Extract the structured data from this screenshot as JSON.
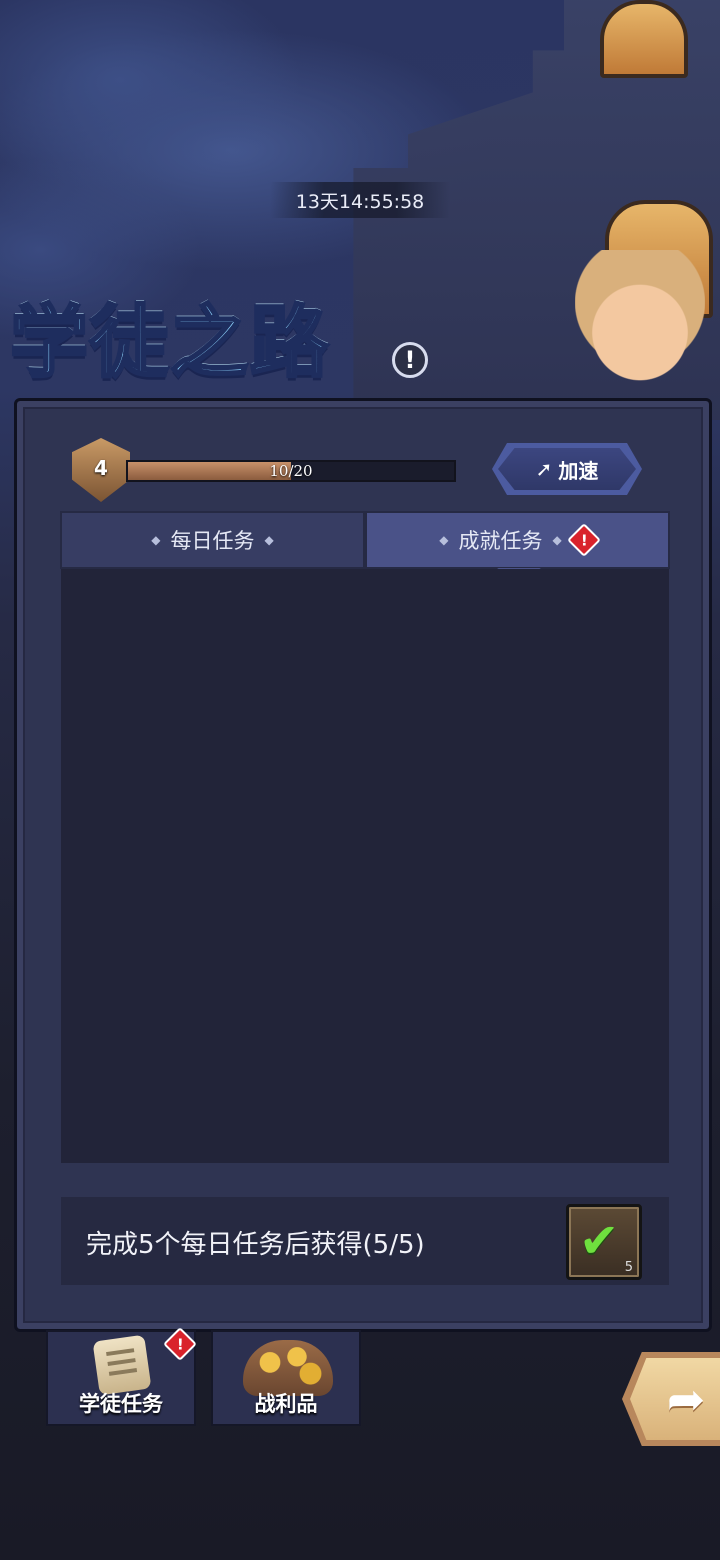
{
  "header": {
    "timer": "13天14:55:58",
    "title": "学徒之路",
    "info_icon": "exclamation-icon"
  },
  "level": {
    "value": "4",
    "progress_text": "10/20",
    "progress_fraction": 0.5
  },
  "speed_button": {
    "label": "加速",
    "icon": "speed-arrow-icon"
  },
  "tabs": [
    {
      "label": "每日任务",
      "active": false,
      "alert": false
    },
    {
      "label": "成就任务",
      "active": true,
      "alert": true
    }
  ],
  "reward": {
    "text": "完成5个每日任务后获得(5/5)",
    "item_count": "5",
    "status": "completed"
  },
  "bottom_nav": [
    {
      "label": "学徒任务",
      "icon": "scroll-icon",
      "alert": true
    },
    {
      "label": "战利品",
      "icon": "treasure-icon",
      "alert": false
    }
  ],
  "alert_symbol": "!",
  "colors": {
    "panel": "#2f3452",
    "active_tab": "#4a5288",
    "alert": "#d9232b",
    "progress_fill": "#c8916a"
  }
}
